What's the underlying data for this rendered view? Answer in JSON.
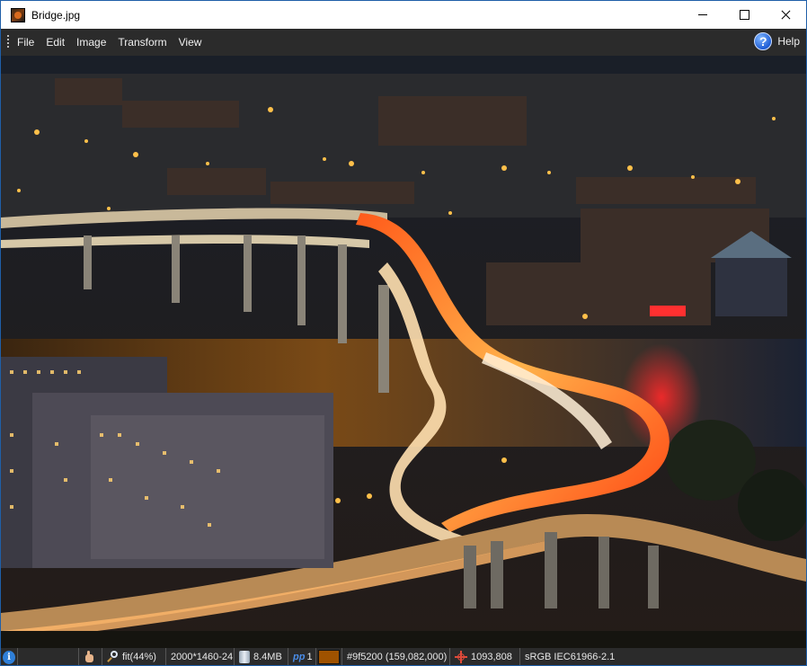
{
  "window": {
    "title": "Bridge.jpg",
    "icon": "photo-icon",
    "controls": [
      "minimize-icon",
      "maximize-icon",
      "close-icon"
    ]
  },
  "menubar": {
    "items": [
      "File",
      "Edit",
      "Image",
      "Transform",
      "View"
    ],
    "help_label": "Help",
    "help_icon": "question-icon"
  },
  "statusbar": {
    "zoom": "fit(44%)",
    "dimensions": "2000*1460-24",
    "memory": "8.4MB",
    "page_prefix": "pp",
    "page": "1",
    "color_swatch": "#9f5200",
    "color_value": "#9f5200 (159,082,000)",
    "cursor_position": "1093,808",
    "color_profile": "sRGB IEC61966-2.1"
  }
}
